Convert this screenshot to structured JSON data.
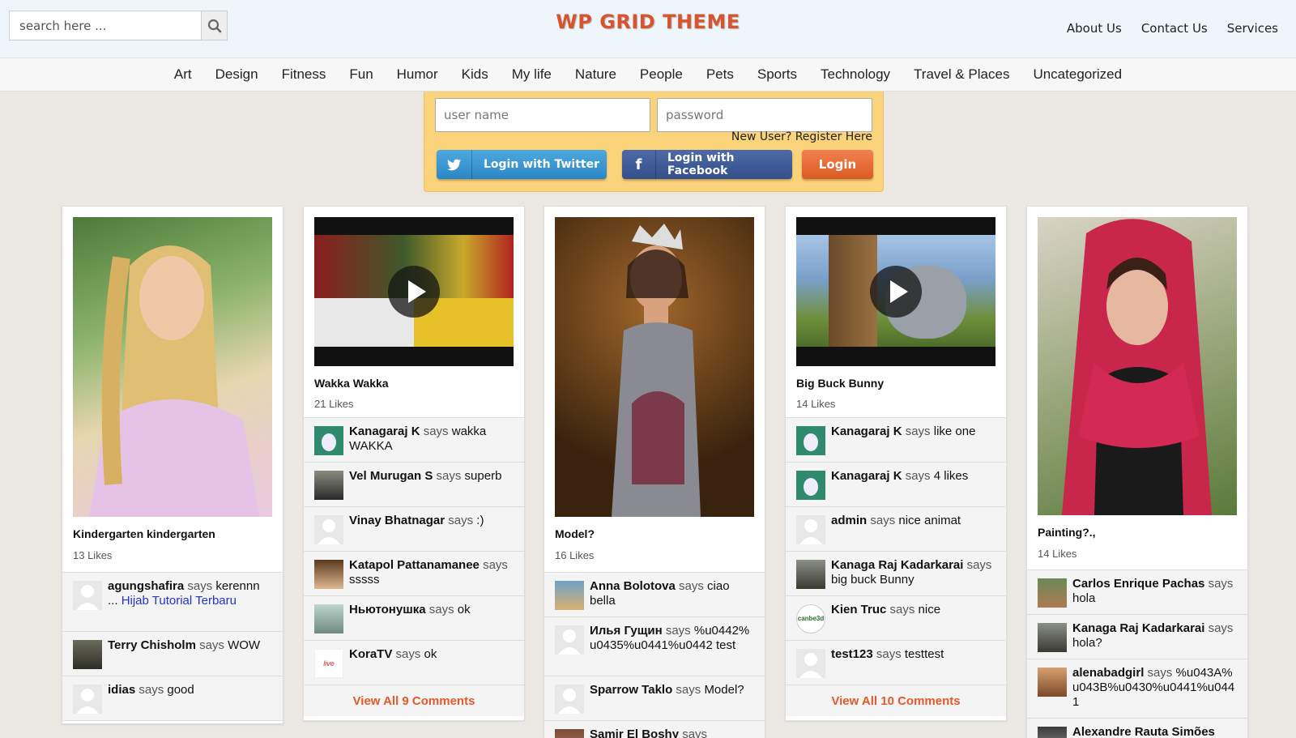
{
  "header": {
    "search_placeholder": "search here ...",
    "site_title": "WP GRID THEME",
    "links": [
      "About Us",
      "Contact Us",
      "Services"
    ]
  },
  "categories": [
    "Art",
    "Design",
    "Fitness",
    "Fun",
    "Humor",
    "Kids",
    "My life",
    "Nature",
    "People",
    "Pets",
    "Sports",
    "Technology",
    "Travel & Places",
    "Uncategorized"
  ],
  "login": {
    "username_placeholder": "user name",
    "password_placeholder": "password",
    "register": "New User? Register Here",
    "twitter": "Login with Twitter",
    "facebook": "Login with Facebook",
    "login": "Login"
  },
  "says": "says",
  "cards": [
    {
      "title": "Kindergarten kindergarten",
      "likes": "13 Likes",
      "comments": [
        {
          "name": "agungshafira",
          "text": "kerennn ...",
          "link": "Hijab Tutorial Terbaru"
        },
        {
          "name": "Terry Chisholm",
          "text": "WOW"
        },
        {
          "name": "idias",
          "text": "good"
        }
      ]
    },
    {
      "title": "Wakka Wakka",
      "likes": "21 Likes",
      "comments": [
        {
          "name": "Kanagaraj K",
          "text": "wakka WAKKA"
        },
        {
          "name": "Vel Murugan S",
          "text": "superb"
        },
        {
          "name": "Vinay Bhatnagar",
          "text": ":)"
        },
        {
          "name": "Katapol Pattanamanee",
          "text": "sssss"
        },
        {
          "name": "Ньютонушка",
          "text": "ok"
        },
        {
          "name": "KoraTV",
          "text": "ok"
        }
      ],
      "view_all": "View All 9 Comments"
    },
    {
      "title": "Model?",
      "likes": "16 Likes",
      "comments": [
        {
          "name": "Anna Bolotova",
          "text": "ciao bella"
        },
        {
          "name": "Илья Гущин",
          "text": "%u0442%u0435%u0441%u0442 test"
        },
        {
          "name": "Sparrow Taklo",
          "text": "Model?"
        },
        {
          "name": "Samir El Boshy",
          "text": ""
        }
      ]
    },
    {
      "title": "Big Buck Bunny",
      "likes": "14 Likes",
      "comments": [
        {
          "name": "Kanagaraj K",
          "text": "like one"
        },
        {
          "name": "Kanagaraj K",
          "text": "4 likes"
        },
        {
          "name": "admin",
          "text": "nice animat"
        },
        {
          "name": "Kanaga Raj Kadarkarai",
          "text": "big buck Bunny"
        },
        {
          "name": "Kien Truc",
          "text": "nice"
        },
        {
          "name": "test123",
          "text": "testtest"
        }
      ],
      "view_all": "View All 10 Comments"
    },
    {
      "title": "Painting?.,",
      "likes": "14 Likes",
      "comments": [
        {
          "name": "Carlos Enrique Pachas",
          "text": "hola"
        },
        {
          "name": "Kanaga Raj Kadarkarai",
          "text": "hola?"
        },
        {
          "name": "alenabadgirl",
          "text": "%u043A%u043B%u0430%u0441%u0441"
        },
        {
          "name": "Alexandre Rauta Simões",
          "text": ""
        }
      ]
    }
  ],
  "avatar_badges": {
    "canbe3d": "canbe3d",
    "live": "live"
  }
}
